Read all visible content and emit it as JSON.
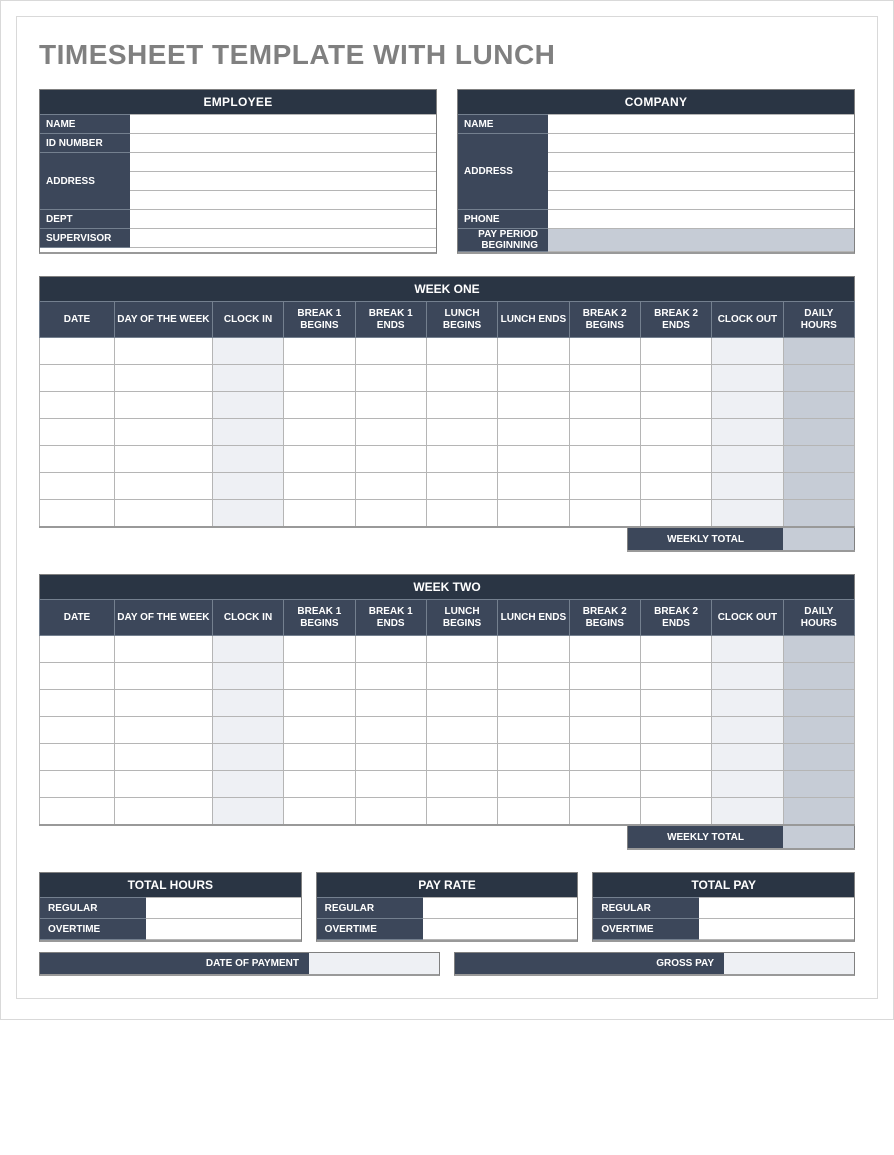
{
  "title": "TIMESHEET TEMPLATE WITH LUNCH",
  "employee": {
    "header": "EMPLOYEE",
    "name_label": "NAME",
    "id_label": "ID NUMBER",
    "addr_label": "ADDRESS",
    "dept_label": "DEPT",
    "sup_label": "SUPERVISOR",
    "name": "",
    "id": "",
    "addr1": "",
    "addr2": "",
    "addr3": "",
    "dept": "",
    "sup": ""
  },
  "company": {
    "header": "COMPANY",
    "name_label": "NAME",
    "addr_label": "ADDRESS",
    "phone_label": "PHONE",
    "pay_period_label": "PAY PERIOD BEGINNING",
    "name": "",
    "addr1": "",
    "addr2": "",
    "addr3": "",
    "phone": "",
    "pay_period": ""
  },
  "cols": {
    "date": "DATE",
    "dow": "DAY OF THE WEEK",
    "clock_in": "CLOCK IN",
    "b1b": "BREAK 1 BEGINS",
    "b1e": "BREAK 1 ENDS",
    "lb": "LUNCH BEGINS",
    "le": "LUNCH ENDS",
    "b2b": "BREAK 2 BEGINS",
    "b2e": "BREAK 2 ENDS",
    "clock_out": "CLOCK OUT",
    "daily": "DAILY HOURS"
  },
  "week1": {
    "header": "WEEK ONE",
    "weekly_total_label": "WEEKLY TOTAL",
    "weekly_total": ""
  },
  "week2": {
    "header": "WEEK TWO",
    "weekly_total_label": "WEEKLY TOTAL",
    "weekly_total": ""
  },
  "totals": {
    "hours_header": "TOTAL HOURS",
    "rate_header": "PAY RATE",
    "pay_header": "TOTAL PAY",
    "regular_label": "REGULAR",
    "overtime_label": "OVERTIME",
    "hours_regular": "",
    "hours_overtime": "",
    "rate_regular": "",
    "rate_overtime": "",
    "pay_regular": "",
    "pay_overtime": ""
  },
  "footer": {
    "date_label": "DATE OF PAYMENT",
    "date_value": "",
    "gross_label": "GROSS PAY",
    "gross_value": ""
  }
}
